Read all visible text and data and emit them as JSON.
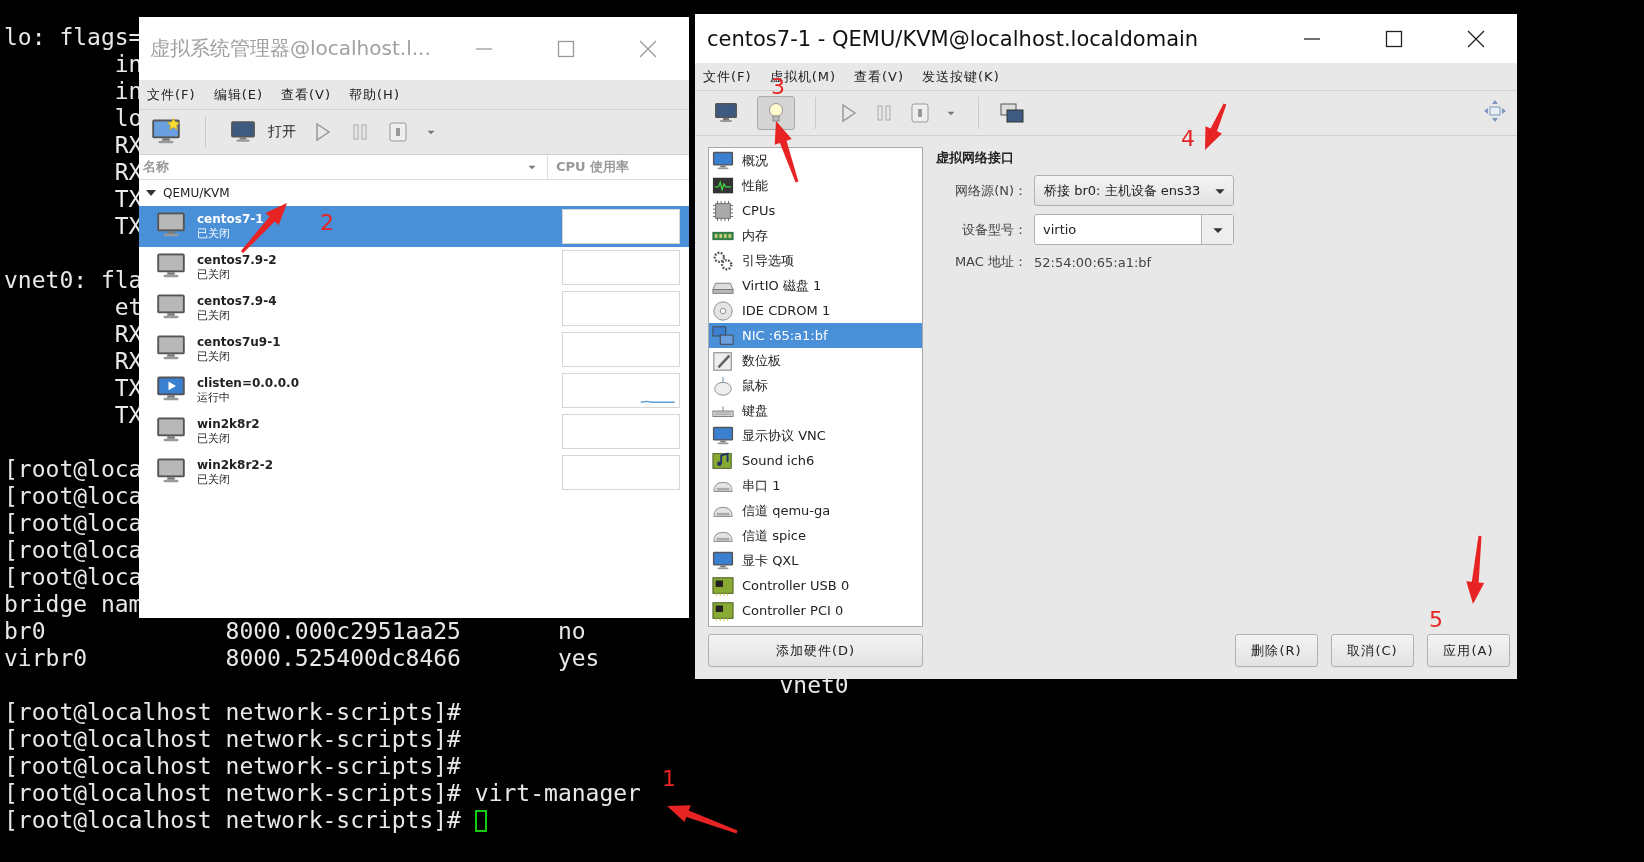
{
  "terminal": {
    "blocks": [
      [
        "lo: flags=",
        "        in",
        "        in",
        "        lo",
        "        RX",
        "        RX",
        "        TX",
        "        TX"
      ],
      [
        "vnet0: fla",
        "        et",
        "        RX",
        "        RX",
        "        TX",
        "        TX"
      ],
      [
        "[root@loca",
        "[root@loca",
        "[root@loca",
        "[root@loca",
        "[root@loca",
        "bridge nam",
        "br0             8000.000c2951aa25       no",
        "virbr0          8000.525400dc8466       yes",
        "                                                        vnet0",
        "[root@localhost network-scripts]#",
        "[root@localhost network-scripts]#",
        "[root@localhost network-scripts]#",
        "[root@localhost network-scripts]# virt-manager",
        "[root@localhost network-scripts]#"
      ]
    ]
  },
  "manager_window": {
    "title": "虚拟系统管理器@localhost.l...",
    "menu": [
      "文件(F)",
      "编辑(E)",
      "查看(V)",
      "帮助(H)"
    ],
    "open_label": "打开",
    "columns": [
      "名称",
      "CPU 使用率"
    ],
    "connection": {
      "name": "QEMU/KVM",
      "expanded": true
    },
    "vms": [
      {
        "name": "centos7-1",
        "status": "已关闭",
        "running": false,
        "selected": true
      },
      {
        "name": "centos7.9-2",
        "status": "已关闭",
        "running": false,
        "selected": false
      },
      {
        "name": "centos7.9-4",
        "status": "已关闭",
        "running": false,
        "selected": false
      },
      {
        "name": "centos7u9-1",
        "status": "已关闭",
        "running": false,
        "selected": false
      },
      {
        "name": "clisten=0.0.0.0",
        "status": "运行中",
        "running": true,
        "selected": false
      },
      {
        "name": "win2k8r2",
        "status": "已关闭",
        "running": false,
        "selected": false
      },
      {
        "name": "win2k8r2-2",
        "status": "已关闭",
        "running": false,
        "selected": false
      }
    ]
  },
  "details_window": {
    "title": "centos7-1 - QEMU/KVM@localhost.localdomain",
    "menu": [
      "文件(F)",
      "虚拟机(M)",
      "查看(V)",
      "发送按键(K)"
    ],
    "view_toggles": [
      {
        "kind": "console",
        "selected": false
      },
      {
        "kind": "details",
        "selected": true
      }
    ],
    "hardware": [
      {
        "label": "概况",
        "kind": "overview",
        "selected": false
      },
      {
        "label": "性能",
        "kind": "performance",
        "selected": false
      },
      {
        "label": "CPUs",
        "kind": "cpu",
        "selected": false
      },
      {
        "label": "内存",
        "kind": "memory",
        "selected": false
      },
      {
        "label": "引导选项",
        "kind": "boot",
        "selected": false
      },
      {
        "label": "VirtIO 磁盘 1",
        "kind": "disk",
        "selected": false
      },
      {
        "label": "IDE CDROM 1",
        "kind": "cdrom",
        "selected": false
      },
      {
        "label": "NIC :65:a1:bf",
        "kind": "nic",
        "selected": true
      },
      {
        "label": "数位板",
        "kind": "tablet",
        "selected": false
      },
      {
        "label": "鼠标",
        "kind": "mouse",
        "selected": false
      },
      {
        "label": "键盘",
        "kind": "keyboard",
        "selected": false
      },
      {
        "label": "显示协议 VNC",
        "kind": "display",
        "selected": false
      },
      {
        "label": "Sound ich6",
        "kind": "sound",
        "selected": false
      },
      {
        "label": "串口 1",
        "kind": "serial",
        "selected": false
      },
      {
        "label": "信道 qemu-ga",
        "kind": "serial",
        "selected": false
      },
      {
        "label": "信道 spice",
        "kind": "serial",
        "selected": false
      },
      {
        "label": "显卡 QXL",
        "kind": "display",
        "selected": false
      },
      {
        "label": "Controller USB 0",
        "kind": "controller",
        "selected": false
      },
      {
        "label": "Controller PCI 0",
        "kind": "controller",
        "selected": false
      }
    ],
    "add_button": "添加硬件(D)",
    "section_title": "虚拟网络接口",
    "fields": [
      {
        "label": "网络源(N)：",
        "value": "桥接  br0: 主机设备  ens33",
        "kind": "dropdown"
      },
      {
        "label": "设备型号：",
        "value": "virtio",
        "kind": "combo"
      },
      {
        "label": "MAC 地址：",
        "value": "52:54:00:65:a1:bf",
        "kind": "text"
      }
    ],
    "buttons": [
      "删除(R)",
      "取消(C)",
      "应用(A)"
    ]
  },
  "annotations": [
    {
      "label": "1"
    },
    {
      "label": "2"
    },
    {
      "label": "3"
    },
    {
      "label": "4"
    },
    {
      "label": "5"
    }
  ]
}
